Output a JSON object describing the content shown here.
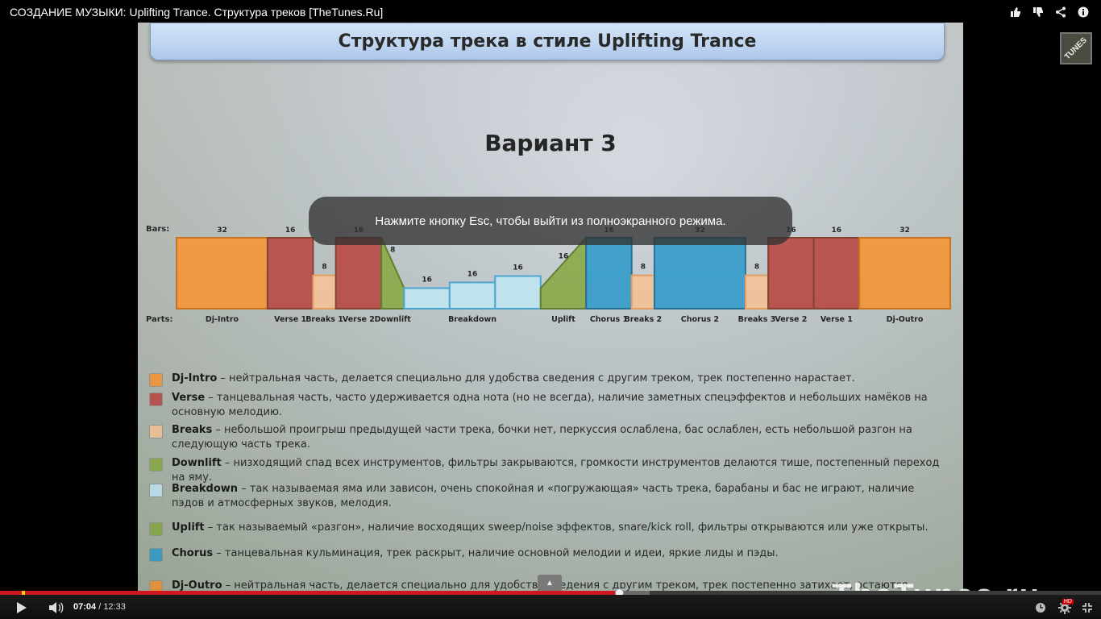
{
  "window": {
    "title": "СОЗДАНИЕ МУЗЫКИ: Uplifting Trance. Структура треков [TheTunes.Ru]"
  },
  "top_icons": [
    "thumbs-up-icon",
    "thumbs-down-icon",
    "share-icon",
    "info-icon"
  ],
  "brand_badge": "TUNES",
  "slide": {
    "header": "Структура трека в стиле Uplifting Trance",
    "variant": "Вариант 3",
    "bars_label": "Bars:",
    "parts_label": "Parts:"
  },
  "chart_data": {
    "type": "bar",
    "x_unit": "bars",
    "segments": [
      {
        "part": "Dj-Intro",
        "bars": 32,
        "level": 1.0,
        "kind": "dj"
      },
      {
        "part": "Verse 1",
        "bars": 16,
        "level": 1.0,
        "kind": "verse"
      },
      {
        "part": "Breaks 1",
        "bars": 8,
        "level": 0.47,
        "kind": "breaks"
      },
      {
        "part": "Verse 2",
        "bars": 16,
        "level": 1.0,
        "kind": "verse"
      },
      {
        "part": "Downlift",
        "bars": 8,
        "level": 0.29,
        "kind": "downlift"
      },
      {
        "part": "",
        "bars": 16,
        "level": 0.29,
        "kind": "breakdown"
      },
      {
        "part": "Breakdown",
        "bars": 16,
        "level": 0.37,
        "kind": "breakdown"
      },
      {
        "part": "",
        "bars": 16,
        "level": 0.46,
        "kind": "breakdown"
      },
      {
        "part": "Uplift",
        "bars": 16,
        "level": 1.0,
        "kind": "uplift"
      },
      {
        "part": "Chorus 1",
        "bars": 16,
        "level": 1.0,
        "kind": "chorus"
      },
      {
        "part": "Breaks 2",
        "bars": 8,
        "level": 0.47,
        "kind": "breaks"
      },
      {
        "part": "Chorus 2",
        "bars": 32,
        "level": 1.0,
        "kind": "chorus"
      },
      {
        "part": "Breaks 3",
        "bars": 8,
        "level": 0.47,
        "kind": "breaks"
      },
      {
        "part": "Verse 2",
        "bars": 16,
        "level": 1.0,
        "kind": "verse"
      },
      {
        "part": "Verse 1",
        "bars": 16,
        "level": 1.0,
        "kind": "verse"
      },
      {
        "part": "Dj-Outro",
        "bars": 32,
        "level": 1.0,
        "kind": "dj"
      }
    ],
    "colors": {
      "dj": "#fb9a3e",
      "verse": "#c0504d",
      "breaks": "#fcc99f",
      "downlift": "#92b050",
      "breakdown": "#c8ecfb",
      "uplift": "#92b050",
      "chorus": "#3da3d4"
    }
  },
  "legend": [
    {
      "name": "Dj-Intro",
      "desc": " – нейтральная часть, делается специально для удобства сведения с другим треком, трек постепенно нарастает.",
      "color": "#fb9a3e"
    },
    {
      "name": "Verse",
      "desc": " – танцевальная часть, часто удерживается одна нота (но не всегда), наличие заметных спецэффектов и небольших намёков на основную мелодию.",
      "color": "#c0504d"
    },
    {
      "name": "Breaks",
      "desc": " – небольшой проигрыш предыдущей части трека, бочки нет, перкуссия ослаблена, бас ослаблен, есть небольшой разгон на следующую часть трека.",
      "color": "#fcc99f"
    },
    {
      "name": "Downlift",
      "desc": " – низходящий спад всех инструментов, фильтры закрываются, громкости инструментов делаются тише, постепенный переход на яму.",
      "color": "#92b050"
    },
    {
      "name": "Breakdown",
      "desc": " – так называемая яма или зависон, очень спокойная и «погружающая» часть трека, барабаны и бас не играют, наличие пэдов и атмосферных звуков, мелодия.",
      "color": "#c8ecfb"
    },
    {
      "name": "Uplift",
      "desc": " – так называемый «разгон», наличие восходящих sweep/noise эффектов, snare/kick roll, фильтры открываются или уже открыты.",
      "color": "#92b050"
    },
    {
      "name": "Chorus",
      "desc": " – танцевальная кульминация, трек раскрыт, наличие основной мелодии и идеи, яркие лиды и пэды.",
      "color": "#3da3d4"
    },
    {
      "name": "Dj-Outro",
      "desc": " – нейтральная часть, делается специально для удобства сведения с другим треком, трек постепенно затихает, остаются звучать только барабаны.",
      "color": "#fb9a3e"
    }
  ],
  "toast": "Нажмите кнопку Esc, чтобы выйти из полноэкранного режима.",
  "watermark": "TheTunes.ru",
  "player": {
    "current_time": "07:04",
    "separator": " / ",
    "duration": "12:33",
    "progress": 0.563,
    "buffered": 0.59,
    "hd": "HD"
  }
}
